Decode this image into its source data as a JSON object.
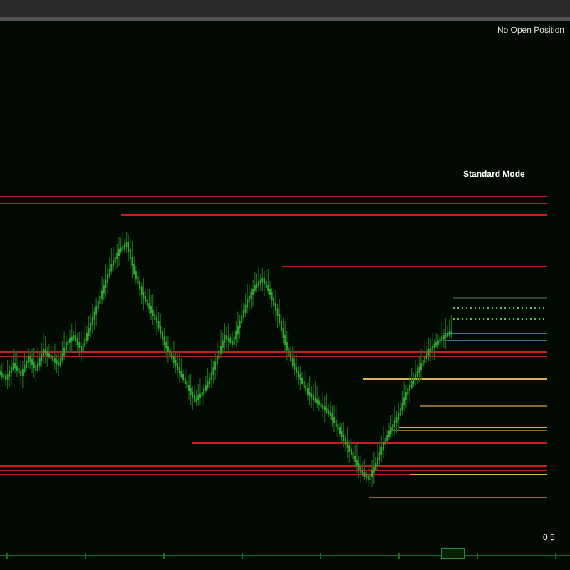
{
  "status": {
    "position": "No Open Position",
    "mode": "Standard Mode"
  },
  "scale": {
    "value": "0.5"
  }
}
